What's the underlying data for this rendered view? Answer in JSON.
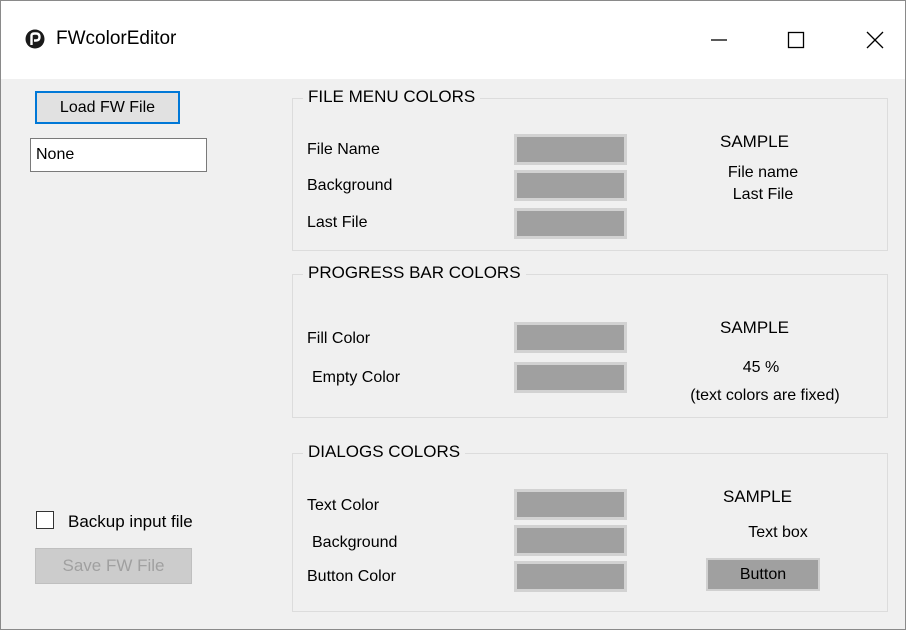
{
  "window": {
    "title": "FWcolorEditor",
    "icons": {
      "app": "app-logo-icon",
      "minimize": "minimize-icon",
      "maximize": "maximize-icon",
      "close": "close-icon"
    }
  },
  "left_panel": {
    "load_button_label": "Load FW File",
    "file_field_value": "None",
    "backup_checkbox": {
      "label": "Backup input file",
      "checked": false
    },
    "save_button_label": "Save FW File",
    "save_button_enabled": false
  },
  "file_menu": {
    "title": "FILE MENU COLORS",
    "rows": [
      {
        "label": "File Name",
        "swatch_color": "#a0a0a0"
      },
      {
        "label": "Background",
        "swatch_color": "#a0a0a0"
      },
      {
        "label": "Last File",
        "swatch_color": "#a0a0a0"
      }
    ],
    "sample_heading": "SAMPLE",
    "sample_file_name": "File name",
    "sample_last_file": "Last File"
  },
  "progress_bar": {
    "title": "PROGRESS BAR COLORS",
    "rows": [
      {
        "label": "Fill Color",
        "swatch_color": "#a0a0a0"
      },
      {
        "label": "Empty Color",
        "swatch_color": "#a0a0a0"
      }
    ],
    "sample_heading": "SAMPLE",
    "sample_percent": "45 %",
    "sample_note": "(text colors are fixed)"
  },
  "dialogs": {
    "title": "DIALOGS COLORS",
    "rows": [
      {
        "label": "Text Color",
        "swatch_color": "#a0a0a0"
      },
      {
        "label": "Background",
        "swatch_color": "#a0a0a0"
      },
      {
        "label": "Button Color",
        "swatch_color": "#a0a0a0"
      }
    ],
    "sample_heading": "SAMPLE",
    "sample_text_box": "Text box",
    "sample_button": "Button"
  },
  "colors": {
    "window_bg": "#f0f0f0",
    "titlebar_bg": "#ffffff",
    "accent": "#0078d7",
    "swatch_gray": "#a0a0a0"
  }
}
